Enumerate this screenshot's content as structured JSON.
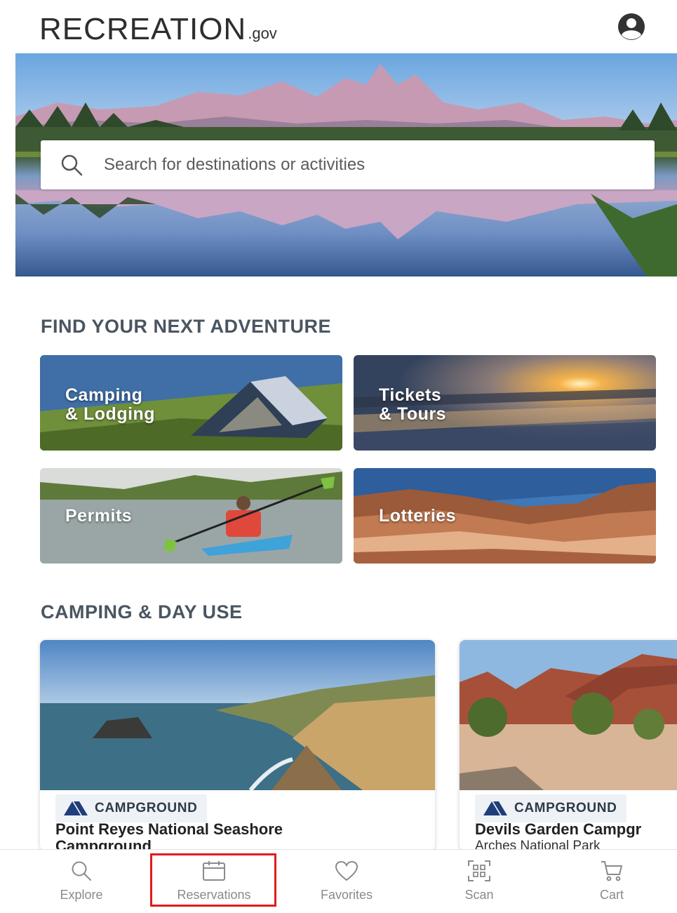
{
  "header": {
    "logo_main": "RECREATION",
    "logo_suffix": ".gov"
  },
  "search": {
    "placeholder": "Search for destinations or activities"
  },
  "sections": {
    "adventure_title": "FIND YOUR NEXT ADVENTURE",
    "camping_title": "CAMPING & DAY USE"
  },
  "tiles": [
    {
      "label": "Camping\n& Lodging"
    },
    {
      "label": "Tickets\n& Tours"
    },
    {
      "label": "Permits"
    },
    {
      "label": "Lotteries"
    }
  ],
  "cards": [
    {
      "badge": "CAMPGROUND",
      "title": "Point Reyes National Seashore",
      "title_line2": "Campground"
    },
    {
      "badge": "CAMPGROUND",
      "title": "Devils Garden Campgr",
      "subtitle": "Arches National Park"
    }
  ],
  "bottom_nav": [
    {
      "label": "Explore",
      "icon": "search-icon"
    },
    {
      "label": "Reservations",
      "icon": "calendar-icon"
    },
    {
      "label": "Favorites",
      "icon": "heart-icon"
    },
    {
      "label": "Scan",
      "icon": "scan-icon"
    },
    {
      "label": "Cart",
      "icon": "cart-icon"
    }
  ],
  "colors": {
    "highlight": "#e21b1b",
    "badge_icon": "#1f3e7a"
  }
}
